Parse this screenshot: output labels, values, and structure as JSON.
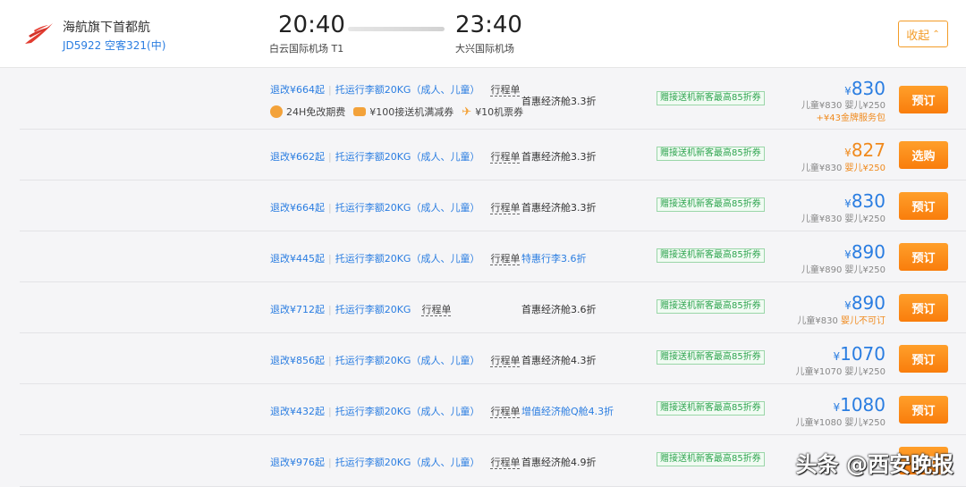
{
  "header": {
    "airline_name": "海航旗下首都航",
    "flight_info": "JD5922 空客321(中)",
    "dep_time": "20:40",
    "dep_airport": "白云国际机场 T1",
    "arr_time": "23:40",
    "arr_airport": "大兴国际机场",
    "collapse_label": "收起",
    "collapse_icon": "chevron-up-icon",
    "logo_icon": "capital-airlines-logo",
    "accent_color": "#f39c27",
    "link_color": "#2a7de1"
  },
  "fares": [
    {
      "change_fee": "退改¥664起",
      "baggage": "托运行李额20KG（成人、儿童）",
      "itinerary": "行程单",
      "perks": [
        "24H免改期费",
        "¥100接送机满减券",
        "¥10机票券"
      ],
      "cabin": "首惠经济舱3.3折",
      "promo": "赠接送机新客最高85折券",
      "price_symbol": "¥",
      "price": "830",
      "child": "儿童¥830",
      "infant": "婴儿¥250",
      "extra": "+¥43金牌服务包",
      "button": "预订"
    },
    {
      "change_fee": "退改¥662起",
      "baggage": "托运行李额20KG（成人、儿童）",
      "itinerary": "行程单",
      "cabin": "首惠经济舱3.3折",
      "promo": "赠接送机新客最高85折券",
      "price_symbol": "¥",
      "price": "827",
      "child": "儿童¥830",
      "infant": "婴儿¥250",
      "button": "选购"
    },
    {
      "change_fee": "退改¥664起",
      "baggage": "托运行李额20KG（成人、儿童）",
      "itinerary": "行程单",
      "cabin": "首惠经济舱3.3折",
      "promo": "赠接送机新客最高85折券",
      "price_symbol": "¥",
      "price": "830",
      "child": "儿童¥830",
      "infant": "婴儿¥250",
      "button": "预订"
    },
    {
      "change_fee": "退改¥445起",
      "baggage": "托运行李额20KG（成人、儿童）",
      "itinerary": "行程单",
      "cabin": "特惠行李3.6折",
      "promo": "赠接送机新客最高85折券",
      "price_symbol": "¥",
      "price": "890",
      "child": "儿童¥890",
      "infant": "婴儿¥250",
      "button": "预订"
    },
    {
      "change_fee": "退改¥712起",
      "baggage": "托运行李额20KG",
      "itinerary": "行程单",
      "cabin": "首惠经济舱3.6折",
      "promo": "赠接送机新客最高85折券",
      "price_symbol": "¥",
      "price": "890",
      "child": "儿童¥830",
      "infant": "婴儿不可订",
      "button": "预订"
    },
    {
      "change_fee": "退改¥856起",
      "baggage": "托运行李额20KG（成人、儿童）",
      "itinerary": "行程单",
      "cabin": "首惠经济舱4.3折",
      "promo": "赠接送机新客最高85折券",
      "price_symbol": "¥",
      "price": "1070",
      "child": "儿童¥1070",
      "infant": "婴儿¥250",
      "button": "预订"
    },
    {
      "change_fee": "退改¥432起",
      "baggage": "托运行李额20KG（成人、儿童）",
      "itinerary": "行程单",
      "cabin": "增值经济舱Q舱4.3折",
      "promo": "赠接送机新客最高85折券",
      "price_symbol": "¥",
      "price": "1080",
      "child": "儿童¥1080",
      "infant": "婴儿¥250",
      "button": "预订"
    },
    {
      "change_fee": "退改¥976起",
      "baggage": "托运行李额20KG（成人、儿童）",
      "itinerary": "行程单",
      "cabin": "首惠经济舱4.9折",
      "promo": "赠接送机新客最高85折券",
      "button": "预订"
    }
  ],
  "watermark": "头条 @西安晚报"
}
